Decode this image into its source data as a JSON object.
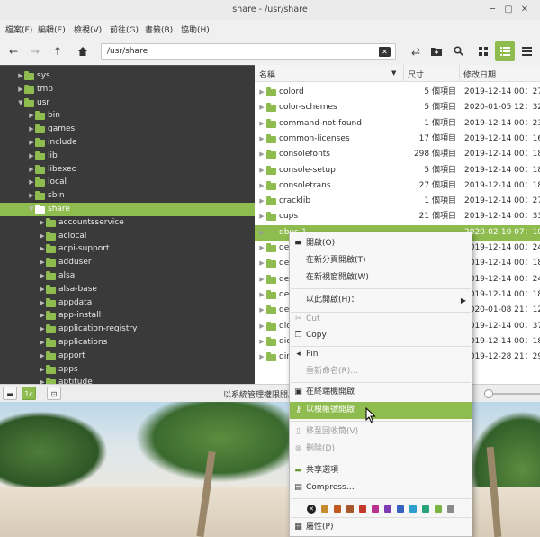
{
  "window": {
    "title": "share - /usr/share",
    "controls": [
      "─",
      "▢",
      "✕"
    ]
  },
  "menu": [
    "檔案(F)",
    "編輯(E)",
    "檢視(V)",
    "前往(G)",
    "書籤(B)",
    "協助(H)"
  ],
  "toolbar": {
    "path": "/usr/share",
    "clear_icon": "✕"
  },
  "sidebar": {
    "items": [
      {
        "label": "sys",
        "depth": 1,
        "expanded": false
      },
      {
        "label": "tmp",
        "depth": 1,
        "expanded": false
      },
      {
        "label": "usr",
        "depth": 1,
        "expanded": true
      },
      {
        "label": "bin",
        "depth": 2,
        "expanded": false
      },
      {
        "label": "games",
        "depth": 2,
        "expanded": false
      },
      {
        "label": "include",
        "depth": 2,
        "expanded": false
      },
      {
        "label": "lib",
        "depth": 2,
        "expanded": false
      },
      {
        "label": "libexec",
        "depth": 2,
        "expanded": false
      },
      {
        "label": "local",
        "depth": 2,
        "expanded": false
      },
      {
        "label": "sbin",
        "depth": 2,
        "expanded": false
      },
      {
        "label": "share",
        "depth": 2,
        "expanded": true,
        "selected": true
      },
      {
        "label": "accountsservice",
        "depth": 3,
        "expanded": false
      },
      {
        "label": "aclocal",
        "depth": 3,
        "expanded": false
      },
      {
        "label": "acpi-support",
        "depth": 3,
        "expanded": false
      },
      {
        "label": "adduser",
        "depth": 3,
        "expanded": false
      },
      {
        "label": "alsa",
        "depth": 3,
        "expanded": false
      },
      {
        "label": "alsa-base",
        "depth": 3,
        "expanded": false
      },
      {
        "label": "appdata",
        "depth": 3,
        "expanded": false
      },
      {
        "label": "app-install",
        "depth": 3,
        "expanded": false
      },
      {
        "label": "application-registry",
        "depth": 3,
        "expanded": false
      },
      {
        "label": "applications",
        "depth": 3,
        "expanded": false
      },
      {
        "label": "apport",
        "depth": 3,
        "expanded": false
      },
      {
        "label": "apps",
        "depth": 3,
        "expanded": false
      },
      {
        "label": "aptitude",
        "depth": 3,
        "expanded": false
      }
    ]
  },
  "columns": {
    "name": "名稱",
    "size": "尺寸",
    "date": "修改日期",
    "sort_indicator": "▼"
  },
  "files": [
    {
      "name": "colord",
      "size": "5 個項目",
      "date": "2019-12-14 00：27"
    },
    {
      "name": "color-schemes",
      "size": "5 個項目",
      "date": "2020-01-05 12：32"
    },
    {
      "name": "command-not-found",
      "size": "1 個項目",
      "date": "2019-12-14 00：23"
    },
    {
      "name": "common-licenses",
      "size": "17 個項目",
      "date": "2019-12-14 00：16"
    },
    {
      "name": "consolefonts",
      "size": "298 個項目",
      "date": "2019-12-14 00：18"
    },
    {
      "name": "console-setup",
      "size": "5 個項目",
      "date": "2019-12-14 00：18"
    },
    {
      "name": "consoletrans",
      "size": "27 個項目",
      "date": "2019-12-14 00：18"
    },
    {
      "name": "cracklib",
      "size": "1 個項目",
      "date": "2019-12-14 00：27"
    },
    {
      "name": "cups",
      "size": "21 個項目",
      "date": "2019-12-14 00：33"
    },
    {
      "name": "dbus-1",
      "size": "",
      "date": "2020-02-10 07：10",
      "selected": true
    },
    {
      "name": "debconf",
      "size": "",
      "date": "2019-12-14 00：24"
    },
    {
      "name": "debhelper",
      "size": "",
      "date": "2019-12-14 00：18"
    },
    {
      "name": "debian-reference",
      "size": "",
      "date": "2019-12-14 00：24"
    },
    {
      "name": "debianutils",
      "size": "",
      "date": "2019-12-14 00：18"
    },
    {
      "name": "desktop-directories",
      "size": "",
      "date": "2020-01-08 21：12"
    },
    {
      "name": "dict",
      "size": "",
      "date": "2019-12-14 00：37"
    },
    {
      "name": "dictionaries-common",
      "size": "",
      "date": "2019-12-14 00：18"
    },
    {
      "name": "dirmngr",
      "size": "",
      "date": "2019-12-28 21：29"
    }
  ],
  "status": {
    "text": "以系統管理權限開啟",
    "buttons": [
      "▬",
      "1c",
      "⊡"
    ]
  },
  "context_menu": {
    "open": "開啟(O)",
    "open_tab": "在新分頁開啟(T)",
    "open_window": "在新視窗開啟(W)",
    "open_with": "以此開啟(H)：",
    "cut": "Cut",
    "copy": "Copy",
    "pin": "Pin",
    "rename": "重新命名(R)…",
    "open_terminal": "在終端機開啟",
    "open_root": "以根帳號開啟",
    "trash": "移至回收筒(V)",
    "delete": "刪除(D)",
    "share": "共享選項",
    "compress": "Compress…",
    "properties": "屬性(P)",
    "submenu_arrow": "▶"
  },
  "tag_colors": [
    "#c88a2e",
    "#c05a1e",
    "#a8562a",
    "#c0392b",
    "#b9318f",
    "#7d3cb5",
    "#3563c0",
    "#2f9fd0",
    "#2aa37a",
    "#7ab543",
    "#8a8a8a"
  ],
  "accent": "#8fbc4f"
}
